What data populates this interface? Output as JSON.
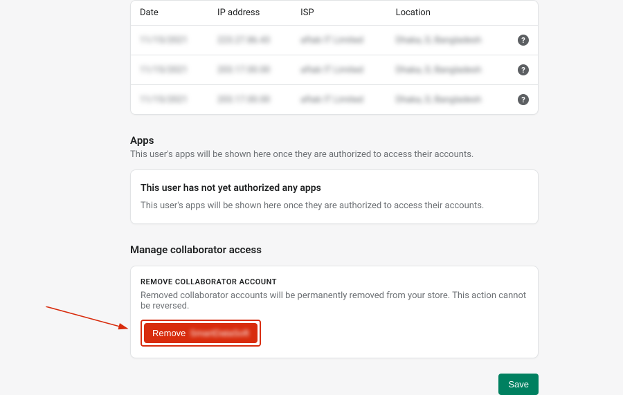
{
  "login_table": {
    "headers": {
      "date": "Date",
      "ip": "IP address",
      "isp": "ISP",
      "location": "Location"
    },
    "rows": [
      {
        "date": "11/15/2021",
        "ip": "223.27.86.43",
        "isp": "aftab IT Limited",
        "location": "Dhaka, D, Bangladesh"
      },
      {
        "date": "11/15/2021",
        "ip": "203.17.00.00",
        "isp": "aftab IT Limited",
        "location": "Dhaka, D, Bangladesh"
      },
      {
        "date": "11/15/2021",
        "ip": "203.17.00.00",
        "isp": "aftab IT Limited",
        "location": "Dhaka, D, Bangladesh"
      }
    ]
  },
  "apps": {
    "title": "Apps",
    "subtitle": "This user's apps will be shown here once they are authorized to access their accounts.",
    "card_title": "This user has not yet authorized any apps",
    "card_sub": "This user's apps will be shown here once they are authorized to access their accounts."
  },
  "collab": {
    "title": "Manage collaborator access",
    "heading": "REMOVE COLLABORATOR ACCOUNT",
    "desc": "Removed collaborator accounts will be permanently removed from your store. This action cannot be reversed.",
    "remove_label": "Remove",
    "remove_name": "SmartDataSoft"
  },
  "footer": {
    "save": "Save"
  }
}
